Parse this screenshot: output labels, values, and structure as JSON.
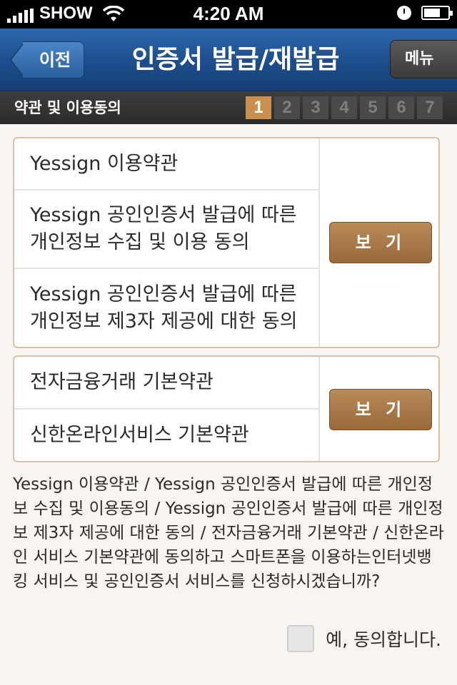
{
  "status_bar": {
    "carrier": "SHOW",
    "time": "4:20 AM"
  },
  "nav": {
    "back_label": "이전",
    "title": "인증서 발급/재발급",
    "menu_label": "메뉴"
  },
  "step_bar": {
    "title": "약관 및 이용동의",
    "steps": [
      "1",
      "2",
      "3",
      "4",
      "5",
      "6",
      "7"
    ],
    "current_step": 1
  },
  "group1": {
    "items": [
      "Yessign 이용약관",
      "Yessign 공인인증서 발급에 따른 개인정보 수집 및 이용 동의",
      "Yessign 공인인증서 발급에 따른 개인정보 제3자 제공에 대한 동의"
    ],
    "view_label": "보 기"
  },
  "group2": {
    "items": [
      "전자금융거래 기본약관",
      "신한온라인서비스 기본약관"
    ],
    "view_label": "보 기"
  },
  "summary": "Yessign 이용약관 / Yessign 공인인증서 발급에 따른 개인정보 수집 및 이용동의 / Yessign 공인인증서 발급에 따른 개인정보 제3자 제공에 대한 동의 / 전자금융거래 기본약관 / 신한온라인 서비스 기본약관에 동의하고 스마트폰을 이용하는인터넷뱅킹 서비스 및 공인인증서 서비스를 신청하시겠습니까?",
  "agree": {
    "label": "예, 동의합니다.",
    "checked": false
  },
  "colors": {
    "nav_blue": "#1d4f8f",
    "accent_brown": "#a8784a",
    "active_step": "#c9904e"
  }
}
